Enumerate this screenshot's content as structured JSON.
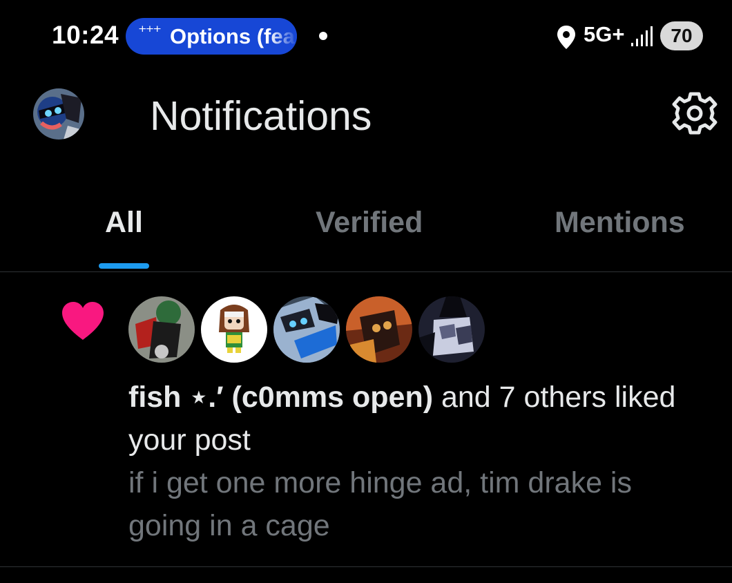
{
  "status_bar": {
    "time": "10:24",
    "pill_text": "Options (fea",
    "network": "5G+",
    "battery": "70",
    "icons": [
      "dots-icon",
      "location-icon",
      "signal-icon",
      "battery-icon"
    ]
  },
  "header": {
    "title": "Notifications",
    "settings_icon": "gear-icon"
  },
  "tabs": [
    {
      "label": "All",
      "active": true
    },
    {
      "label": "Verified",
      "active": false
    },
    {
      "label": "Mentions",
      "active": false
    }
  ],
  "notification": {
    "type_icon": "heart-icon",
    "actor": "fish ⋆.′ (c0mms open)",
    "action": " and 7 others liked your post",
    "post_text": "if i get one more hinge ad, tim drake is going in a cage"
  },
  "colors": {
    "background": "#000000",
    "accent": "#1d9bf0",
    "like": "#f91880",
    "muted": "#71767b",
    "pill": "#1747d6"
  }
}
